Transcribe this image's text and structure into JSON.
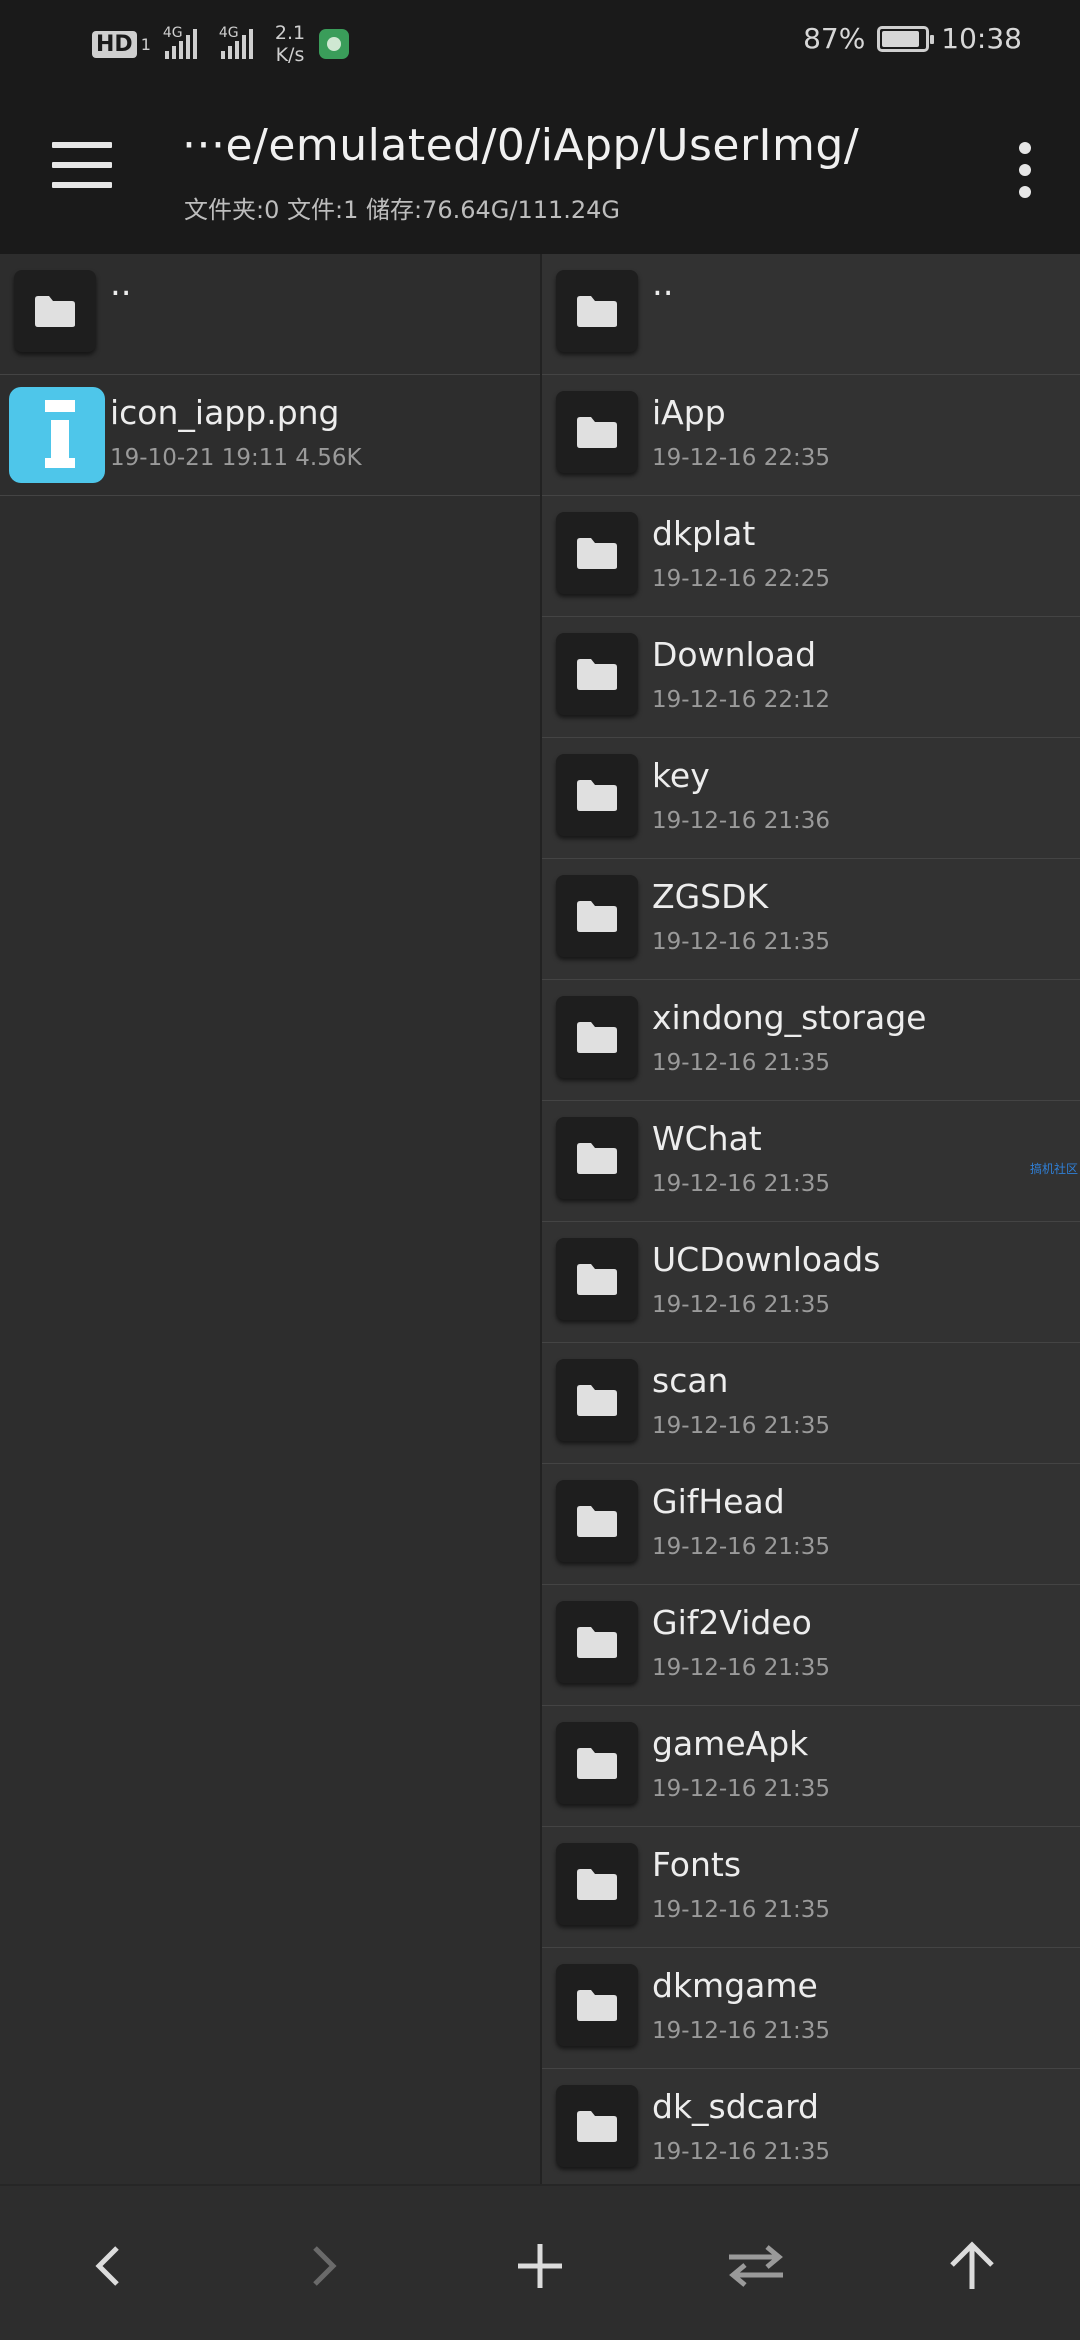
{
  "status_bar": {
    "hd": "HD",
    "sim_slot": "1",
    "net1": "4G",
    "net2": "4G",
    "speed_value": "2.1",
    "speed_unit": "K/s",
    "battery_percent": "87%",
    "battery_level": 0.87,
    "time": "10:38"
  },
  "header": {
    "path": "···e/emulated/0/iApp/UserImg/",
    "info": "文件夹:0  文件:1  储存:76.64G/111.24G"
  },
  "left_pane": {
    "up_label": "..",
    "files": [
      {
        "name": "icon_iapp.png",
        "meta": "19-10-21 19:11  4.56K"
      }
    ]
  },
  "right_pane": {
    "up_label": "..",
    "folders": [
      {
        "name": "iApp",
        "date": "19-12-16 22:35"
      },
      {
        "name": "dkplat",
        "date": "19-12-16 22:25"
      },
      {
        "name": "Download",
        "date": "19-12-16 22:12"
      },
      {
        "name": "key",
        "date": "19-12-16 21:36"
      },
      {
        "name": "ZGSDK",
        "date": "19-12-16 21:35"
      },
      {
        "name": "xindong_storage",
        "date": "19-12-16 21:35"
      },
      {
        "name": "WChat",
        "date": "19-12-16 21:35"
      },
      {
        "name": "UCDownloads",
        "date": "19-12-16 21:35"
      },
      {
        "name": "scan",
        "date": "19-12-16 21:35"
      },
      {
        "name": "GifHead",
        "date": "19-12-16 21:35"
      },
      {
        "name": "Gif2Video",
        "date": "19-12-16 21:35"
      },
      {
        "name": "gameApk",
        "date": "19-12-16 21:35"
      },
      {
        "name": "Fonts",
        "date": "19-12-16 21:35"
      },
      {
        "name": "dkmgame",
        "date": "19-12-16 21:35"
      },
      {
        "name": "dk_sdcard",
        "date": "19-12-16 21:35"
      }
    ]
  },
  "watermark": "搞机社区",
  "bottom_nav": {
    "icons": [
      "chevron-left-icon",
      "chevron-right-icon",
      "plus-icon",
      "swap-icon",
      "arrow-up-icon"
    ]
  },
  "colors": {
    "background": "#2d2d2d",
    "bar": "#1a1a1a",
    "image_tile": "#4ec6ea"
  }
}
